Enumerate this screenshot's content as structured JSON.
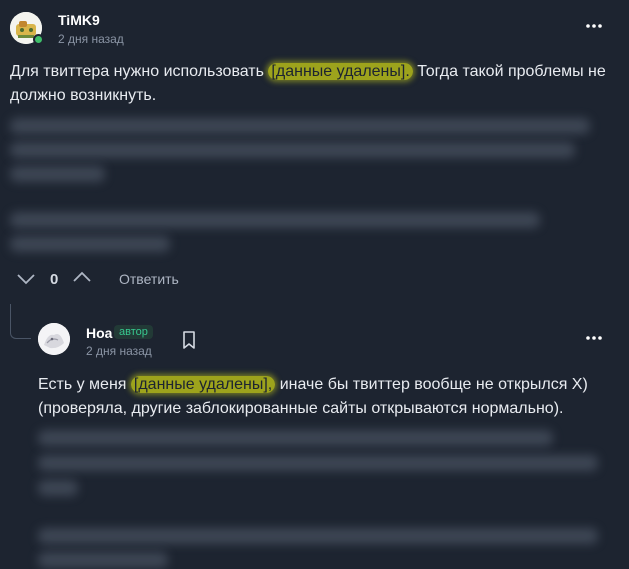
{
  "comment1": {
    "username": "TiMK9",
    "timestamp": "2 дня назад",
    "text_before": "Для твиттера нужно использовать ",
    "redacted": "[данные удалены].",
    "text_after": " Тогда такой проблемы не должно возникнуть.",
    "avatar_icon": "avatar-image",
    "menu_icon": "kebab-menu-icon",
    "votes": {
      "count": "0",
      "down_icon": "chevron-down-icon",
      "up_icon": "chevron-up-icon"
    },
    "reply_label": "Ответить"
  },
  "comment2": {
    "username": "Ноа",
    "badge": "автор",
    "timestamp": "2 дня назад",
    "text_before": "Есть у меня ",
    "redacted": "[данные удалены],",
    "text_after": " иначе бы твиттер вообще не открылся Х) (проверяла, другие заблокированные сайты открываются нормально).",
    "bookmark_icon": "bookmark-icon",
    "menu_icon": "kebab-menu-icon"
  },
  "colors": {
    "background": "#1d2430",
    "highlight": "#9da31c",
    "author_badge": "#37c88f"
  }
}
